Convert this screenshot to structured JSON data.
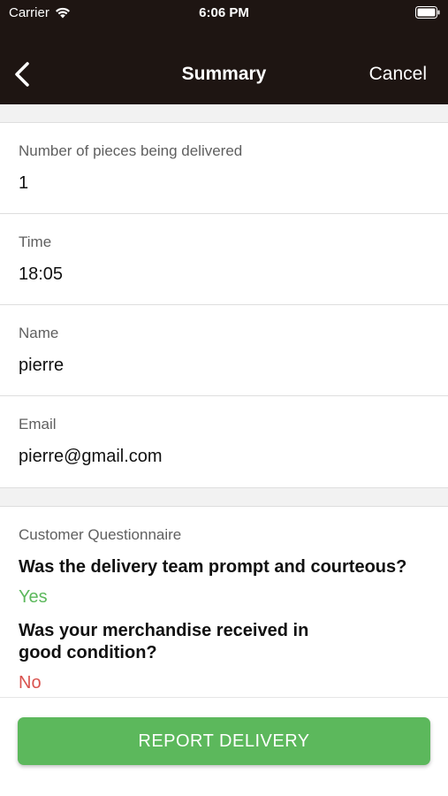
{
  "status_bar": {
    "carrier": "Carrier",
    "time": "6:06 PM"
  },
  "nav": {
    "title": "Summary",
    "cancel_label": "Cancel"
  },
  "fields": [
    {
      "label": "Number of pieces being delivered",
      "value": "1"
    },
    {
      "label": "Time",
      "value": "18:05"
    },
    {
      "label": "Name",
      "value": "pierre"
    },
    {
      "label": "Email",
      "value": "pierre@gmail.com"
    }
  ],
  "questionnaire": {
    "heading": "Customer Questionnaire",
    "questions": [
      {
        "question": "Was the delivery team prompt and courteous?",
        "answer": "Yes"
      },
      {
        "question": "Was your merchandise received in good condition?",
        "answer": "No"
      }
    ]
  },
  "footer": {
    "report_label": "REPORT DELIVERY"
  },
  "colors": {
    "nav_bg": "#1e1512",
    "accent_green": "#5cb85c",
    "answer_no": "#d9534f"
  }
}
